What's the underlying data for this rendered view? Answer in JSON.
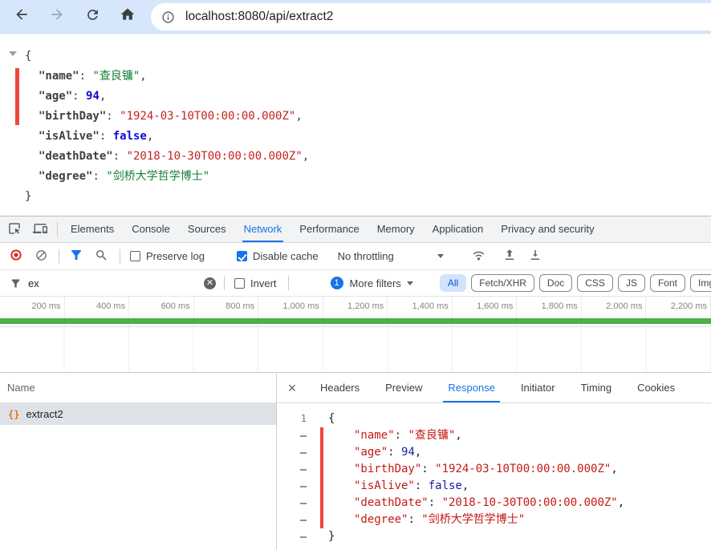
{
  "browser_toolbar": {
    "url": "localhost:8080/api/extract2"
  },
  "json_document": {
    "open_brace": "{",
    "close_brace": "}",
    "separator": ": ",
    "entries": [
      {
        "key": "\"name\"",
        "value": "\"查良镛\"",
        "comma": ",",
        "kind": "string"
      },
      {
        "key": "\"age\"",
        "value": "94",
        "comma": ",",
        "kind": "number"
      },
      {
        "key": "\"birthDay\"",
        "value": "\"1924-03-10T00:00:00.000Z\"",
        "comma": ",",
        "kind": "date"
      },
      {
        "key": "\"isAlive\"",
        "value": "false",
        "comma": ",",
        "kind": "boolean"
      },
      {
        "key": "\"deathDate\"",
        "value": "\"2018-10-30T00:00:00.000Z\"",
        "comma": ",",
        "kind": "date"
      },
      {
        "key": "\"degree\"",
        "value": "\"剑桥大学哲学博士\"",
        "comma": "",
        "kind": "string"
      }
    ]
  },
  "devtools": {
    "tabs": [
      {
        "label": "Elements",
        "selected": false
      },
      {
        "label": "Console",
        "selected": false
      },
      {
        "label": "Sources",
        "selected": false
      },
      {
        "label": "Network",
        "selected": true
      },
      {
        "label": "Performance",
        "selected": false
      },
      {
        "label": "Memory",
        "selected": false
      },
      {
        "label": "Application",
        "selected": false
      },
      {
        "label": "Privacy and security",
        "selected": false
      }
    ],
    "network_toolbar": {
      "preserve_log_label": "Preserve log",
      "preserve_log_checked": false,
      "disable_cache_label": "Disable cache",
      "disable_cache_checked": true,
      "throttling_value": "No throttling"
    },
    "filter_bar": {
      "filter_value": "ex",
      "clear_glyph": "✕",
      "invert_label": "Invert",
      "invert_checked": false,
      "more_filters_badge": "1",
      "more_filters_label": "More filters",
      "type_pills": [
        {
          "label": "All",
          "selected": true
        },
        {
          "label": "Fetch/XHR",
          "selected": false
        },
        {
          "label": "Doc",
          "selected": false
        },
        {
          "label": "CSS",
          "selected": false
        },
        {
          "label": "JS",
          "selected": false
        },
        {
          "label": "Font",
          "selected": false
        },
        {
          "label": "Img",
          "selected": false
        }
      ]
    },
    "timeline": {
      "tick_labels": [
        "200 ms",
        "400 ms",
        "600 ms",
        "800 ms",
        "1,000 ms",
        "1,200 ms",
        "1,400 ms",
        "1,600 ms",
        "1,800 ms",
        "2,000 ms",
        "2,200 ms"
      ]
    },
    "requests_table": {
      "name_header": "Name",
      "rows": [
        {
          "name": "extract2",
          "icon_text": "{}",
          "selected": true
        }
      ]
    },
    "detail_panel": {
      "close_glyph": "×",
      "tabs": [
        {
          "label": "Headers",
          "selected": false
        },
        {
          "label": "Preview",
          "selected": false
        },
        {
          "label": "Response",
          "selected": true
        },
        {
          "label": "Initiator",
          "selected": false
        },
        {
          "label": "Timing",
          "selected": false
        },
        {
          "label": "Cookies",
          "selected": false
        }
      ],
      "editor": {
        "first_line_number": "1"
      }
    }
  },
  "icons": {
    "back": "back-arrow-icon",
    "forward": "forward-arrow-icon",
    "reload": "reload-icon",
    "home": "home-icon",
    "page_info": "info-icon",
    "inspect": "inspect-element-icon",
    "device_toolbar": "device-toolbar-icon",
    "record": "record-icon",
    "clear_log": "block-icon",
    "filter": "funnel-icon",
    "search": "search-icon",
    "network_conditions": "wifi-icon",
    "import_har": "upload-icon",
    "export_har": "download-icon",
    "request_type": "json-braces-icon",
    "json_expander": "triangle-down-icon"
  },
  "colors": {
    "accent_blue": "#1a73e8",
    "toolbar_blue_bg": "#d7e7fb",
    "record_red": "#d93025",
    "marker_red": "#f0453c",
    "waterfall_green": "#47b14b",
    "json_string_green": "#188038",
    "json_number_blue": "#0d0dd6",
    "json_date_red": "#c5221f",
    "code_string_red": "#c41a16",
    "code_number_blue": "#1a1aa8",
    "pill_selected_bg": "#d3e3fd",
    "pill_selected_text": "#0b57d0",
    "selected_row_bg": "#dee2e7"
  }
}
